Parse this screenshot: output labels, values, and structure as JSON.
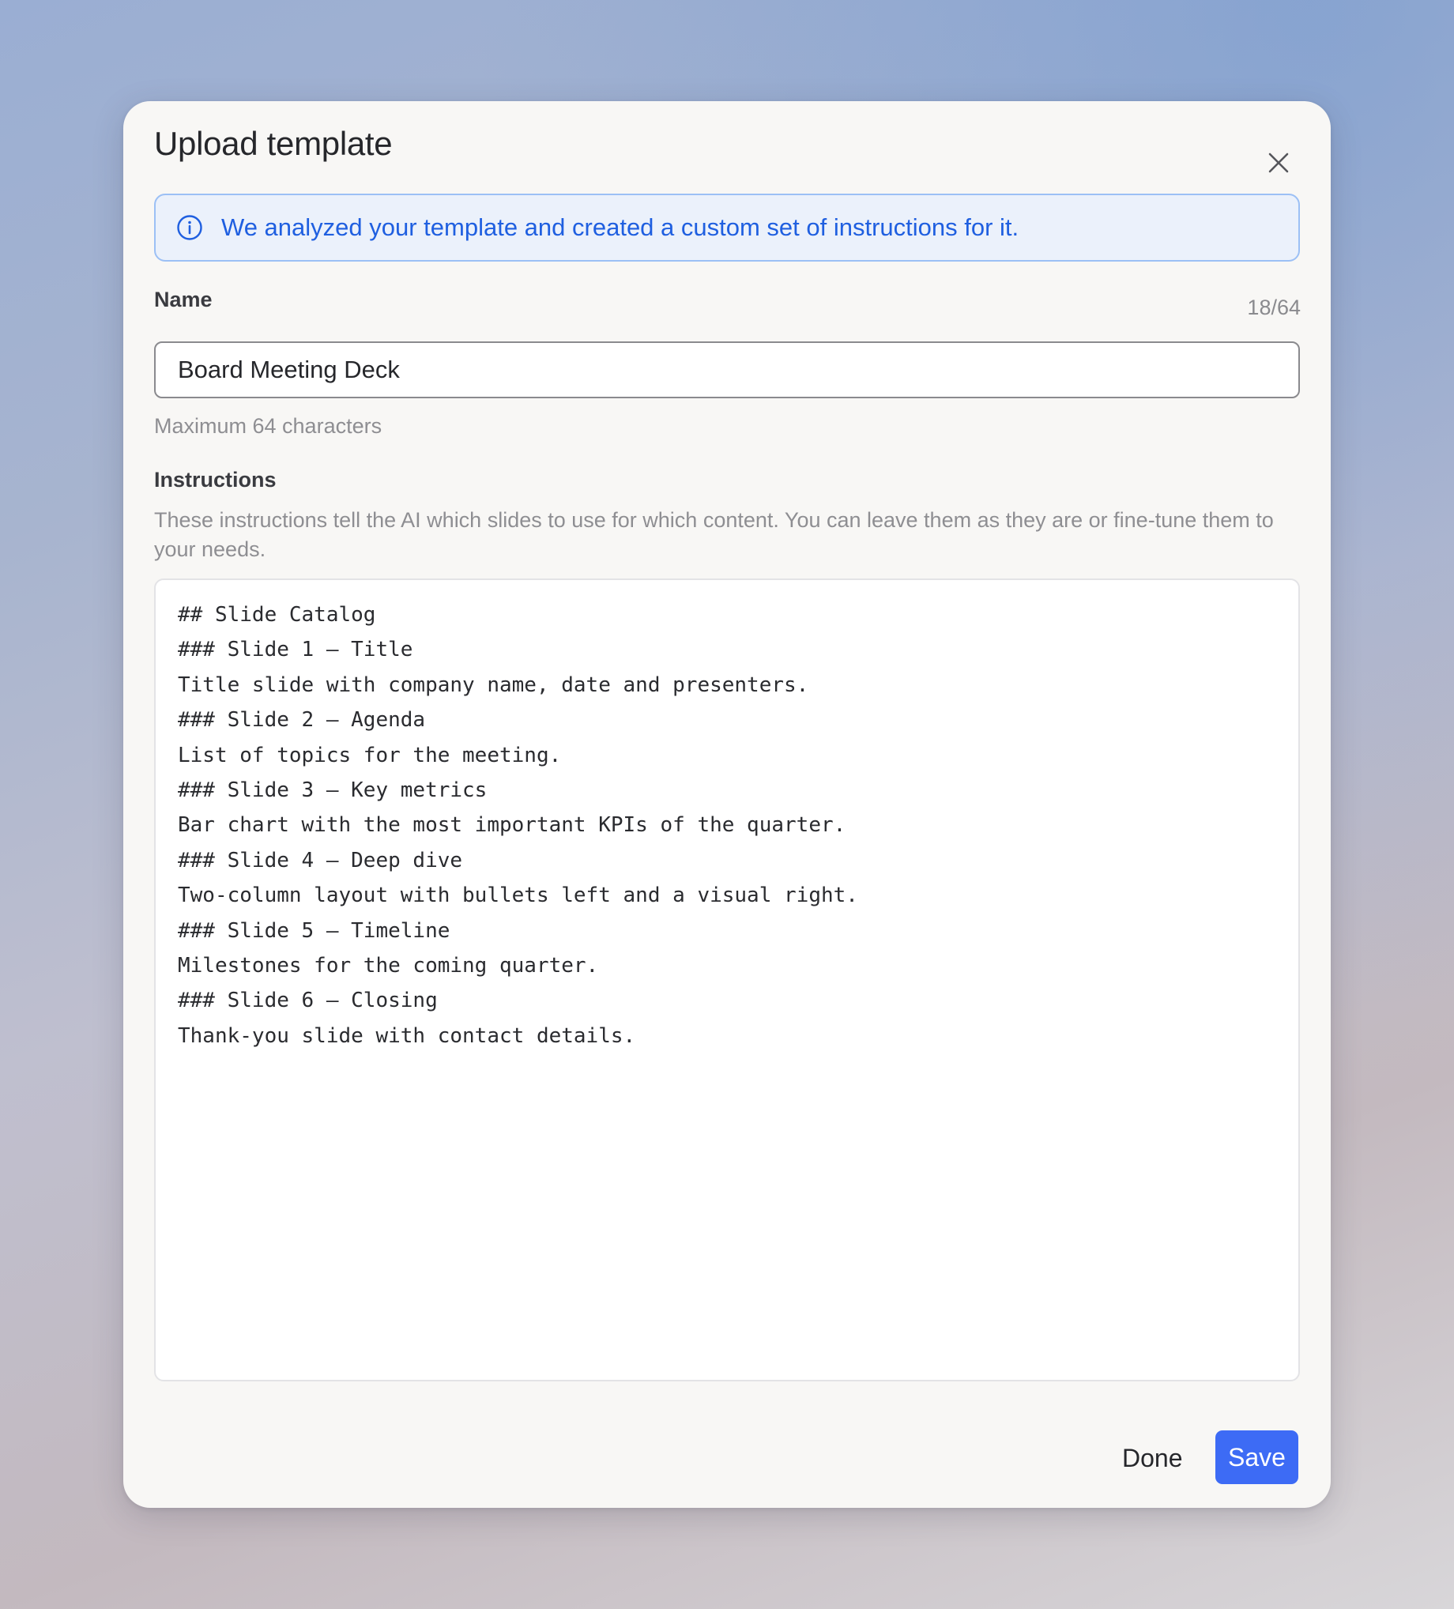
{
  "modal": {
    "title": "Upload template"
  },
  "info_banner": {
    "text": "We analyzed your template and created a custom set of instructions for it."
  },
  "name_field": {
    "label": "Name",
    "counter": "18/64",
    "value": "Board Meeting Deck",
    "helper": "Maximum 64 characters"
  },
  "instructions_field": {
    "label": "Instructions",
    "description": "These instructions tell the AI which slides to use for which content. You can leave them as they are or fine-tune them to your needs.",
    "value": "## Slide Catalog\n### Slide 1 — Title\nTitle slide with company name, date and presenters.\n### Slide 2 — Agenda\nList of topics for the meeting.\n### Slide 3 — Key metrics\nBar chart with the most important KPIs of the quarter.\n### Slide 4 — Deep dive\nTwo-column layout with bullets left and a visual right.\n### Slide 5 — Timeline\nMilestones for the coming quarter.\n### Slide 6 — Closing\nThank-you slide with contact details."
  },
  "footer": {
    "done_label": "Done",
    "save_label": "Save"
  },
  "colors": {
    "accent": "#3d6bf5",
    "info_text": "#1f5fe0",
    "info_bg": "#ebf1fb",
    "info_border": "#9cc0f5"
  },
  "icons": {
    "close": "close-icon",
    "info": "info-icon"
  }
}
